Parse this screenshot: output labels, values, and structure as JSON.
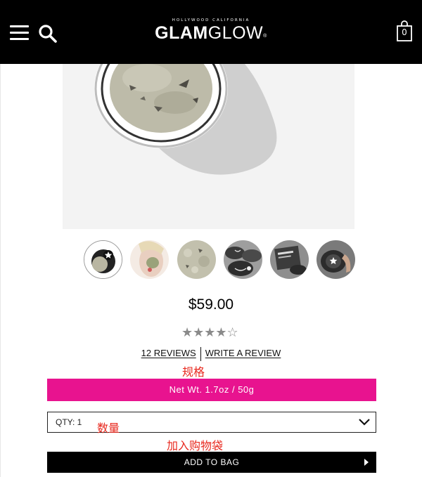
{
  "header": {
    "logo_tagline": "HOLLYWOOD CALIFORNIA",
    "logo_brand_bold": "GLAM",
    "logo_brand_light": "GLOW",
    "logo_mark": "®",
    "bag_count": "0",
    "icons": [
      "menu-icon",
      "search-icon",
      "shopping-bag-icon"
    ],
    "background": "#000000"
  },
  "product": {
    "price": "$59.00",
    "rating": {
      "value": 4,
      "max": 5
    },
    "stars_filled": "★★★★",
    "stars_empty": "☆",
    "reviews_link": "12 REVIEWS",
    "write_review_link": "WRITE A REVIEW",
    "thumbnails": [
      "thumb-jar-open",
      "thumb-model-face",
      "thumb-mask-texture",
      "thumb-jars-grouped",
      "thumb-product-box",
      "thumb-hand-jar"
    ],
    "active_thumbnail": 0
  },
  "annotations": {
    "spec": "规格",
    "quantity": "数量",
    "add_to_bag": "加入购物袋"
  },
  "size_option": {
    "label": "Net Wt. 1.7oz / 50g",
    "color": "#e8138f"
  },
  "quantity": {
    "label": "QTY: 1"
  },
  "add_to_bag": {
    "label": "ADD TO BAG"
  }
}
